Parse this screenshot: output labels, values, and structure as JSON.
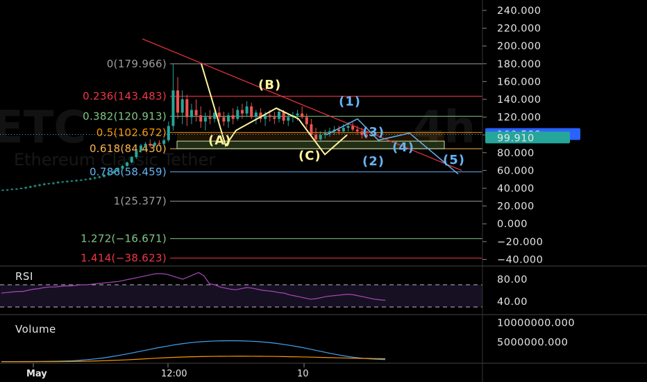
{
  "chart_data": {
    "type": "candlestick",
    "symbol_watermark": "ETC",
    "interval_watermark": "4h",
    "watermark_subtitle": "Ethereum Classic Tether",
    "price_axis": {
      "ticks": [
        "240.000",
        "220.000",
        "200.000",
        "180.000",
        "160.000",
        "140.000",
        "120.000",
        "100.000",
        "80.000",
        "60.000",
        "40.000",
        "20.000",
        "0.000",
        "−20.000",
        "−40.000"
      ],
      "tick_values": [
        240,
        220,
        200,
        180,
        160,
        140,
        120,
        100,
        80,
        60,
        40,
        20,
        0,
        -20,
        -40
      ],
      "ylim": [
        -42,
        247
      ]
    },
    "current_price": {
      "label": "100.588",
      "value": 100.588,
      "color": "#2962ff"
    },
    "secondary_price": {
      "label": "99.910",
      "value": 99.91,
      "color": "#26a69a"
    },
    "time_axis": {
      "labels": [
        "May",
        "12:00",
        "10"
      ]
    },
    "fibonacci": [
      {
        "label": "0(179.966)",
        "value": 179.966,
        "color": "#9e9e9e"
      },
      {
        "label": "0.236(143.483)",
        "value": 143.483,
        "color": "#f23645"
      },
      {
        "label": "0.382(120.913)",
        "value": 120.913,
        "color": "#81c784"
      },
      {
        "label": "0.5(102.672)",
        "value": 102.672,
        "color": "#ff9800"
      },
      {
        "label": "0.618(84.430)",
        "value": 84.43,
        "color": "#ffb74d"
      },
      {
        "label": "0.786(58.459)",
        "value": 58.459,
        "color": "#64b5f6"
      },
      {
        "label": "1(25.377)",
        "value": 25.377,
        "color": "#9e9e9e"
      },
      {
        "label": "1.272(−16.671)",
        "value": -16.671,
        "color": "#81c784"
      },
      {
        "label": "1.414(−38.623)",
        "value": -38.623,
        "color": "#f23645"
      }
    ],
    "waves_abc": [
      {
        "label": "(A)",
        "value": 81,
        "color": "#fff59d"
      },
      {
        "label": "(B)",
        "value": 138,
        "color": "#fff59d"
      },
      {
        "label": "(C)",
        "value": 65,
        "color": "#fff59d"
      }
    ],
    "waves_impulse": [
      {
        "label": "(1)",
        "value": 133,
        "color": "#64b5f6"
      },
      {
        "label": "(2)",
        "value": 58,
        "color": "#64b5f6"
      },
      {
        "label": "(3)",
        "value": 98,
        "color": "#64b5f6"
      },
      {
        "label": "(4)",
        "value": 79,
        "color": "#64b5f6"
      },
      {
        "label": "(5)",
        "value": 70,
        "color": "#64b5f6"
      }
    ],
    "candles": [
      [
        38,
        39,
        37,
        38
      ],
      [
        38,
        39,
        37,
        38.5
      ],
      [
        38.5,
        40,
        38,
        39
      ],
      [
        39,
        40,
        38,
        39.5
      ],
      [
        39.5,
        41,
        39,
        40
      ],
      [
        40,
        42,
        39,
        41
      ],
      [
        41,
        43,
        40,
        42
      ],
      [
        42,
        44,
        41,
        43
      ],
      [
        43,
        45,
        42,
        44
      ],
      [
        44,
        46,
        43,
        45
      ],
      [
        45,
        46,
        44,
        45.5
      ],
      [
        45.5,
        47,
        44,
        46
      ],
      [
        46,
        48,
        45,
        47
      ],
      [
        47,
        48,
        46,
        47.5
      ],
      [
        47.5,
        49,
        46,
        48
      ],
      [
        48,
        49,
        47,
        48.5
      ],
      [
        48.5,
        50,
        47,
        49
      ],
      [
        49,
        50,
        48,
        49.5
      ],
      [
        49.5,
        51,
        49,
        50
      ],
      [
        50,
        52,
        49,
        51
      ],
      [
        51,
        53,
        50,
        52
      ],
      [
        52,
        54,
        51,
        53
      ],
      [
        53,
        56,
        52,
        55
      ],
      [
        55,
        58,
        54,
        57
      ],
      [
        57,
        60,
        56,
        59
      ],
      [
        59,
        63,
        58,
        62
      ],
      [
        62,
        66,
        61,
        65
      ],
      [
        65,
        70,
        64,
        69
      ],
      [
        69,
        76,
        68,
        75
      ],
      [
        75,
        83,
        73,
        82
      ],
      [
        82,
        90,
        80,
        88
      ],
      [
        88,
        92,
        84,
        90
      ],
      [
        90,
        95,
        86,
        88
      ],
      [
        88,
        93,
        85,
        91
      ],
      [
        91,
        94,
        87,
        90
      ],
      [
        90,
        96,
        88,
        94
      ],
      [
        94,
        115,
        92,
        110
      ],
      [
        110,
        180,
        105,
        150
      ],
      [
        150,
        165,
        118,
        125
      ],
      [
        125,
        150,
        112,
        140
      ],
      [
        140,
        145,
        110,
        120
      ],
      [
        120,
        135,
        112,
        128
      ],
      [
        128,
        140,
        115,
        122
      ],
      [
        122,
        132,
        108,
        115
      ],
      [
        115,
        125,
        105,
        120
      ],
      [
        120,
        128,
        112,
        118
      ],
      [
        118,
        130,
        114,
        125
      ],
      [
        125,
        132,
        115,
        120
      ],
      [
        120,
        126,
        110,
        115
      ],
      [
        115,
        125,
        108,
        122
      ],
      [
        122,
        130,
        112,
        118
      ],
      [
        118,
        132,
        116,
        128
      ],
      [
        128,
        135,
        118,
        124
      ],
      [
        124,
        138,
        120,
        132
      ],
      [
        132,
        136,
        118,
        120
      ],
      [
        120,
        128,
        112,
        125
      ],
      [
        125,
        130,
        114,
        118
      ],
      [
        118,
        126,
        110,
        122
      ],
      [
        122,
        128,
        115,
        120
      ],
      [
        120,
        126,
        112,
        118
      ],
      [
        118,
        130,
        114,
        126
      ],
      [
        126,
        128,
        112,
        116
      ],
      [
        116,
        124,
        110,
        120
      ],
      [
        120,
        126,
        114,
        122
      ],
      [
        122,
        128,
        116,
        124
      ],
      [
        124,
        132,
        118,
        120
      ],
      [
        120,
        124,
        108,
        112
      ],
      [
        112,
        118,
        98,
        100
      ],
      [
        100,
        108,
        92,
        95
      ],
      [
        95,
        104,
        92,
        100
      ],
      [
        100,
        106,
        96,
        102
      ],
      [
        102,
        108,
        98,
        104
      ],
      [
        104,
        110,
        100,
        106
      ],
      [
        106,
        110,
        100,
        104
      ],
      [
        104,
        112,
        102,
        108
      ],
      [
        108,
        114,
        104,
        110
      ],
      [
        110,
        114,
        104,
        106
      ],
      [
        106,
        110,
        100,
        104
      ],
      [
        104,
        108,
        96,
        100
      ],
      [
        100,
        104,
        96,
        98
      ]
    ],
    "resistance_line": {
      "from": [
        0.33,
        208
      ],
      "to": [
        0.93,
        60
      ],
      "color": "#f23645"
    },
    "rsi": {
      "title": "RSI",
      "ticks": [
        "80.00",
        "40.00"
      ],
      "tick_values": [
        80,
        40
      ],
      "upper": 70,
      "lower": 30,
      "ylim": [
        20,
        100
      ],
      "color": "#ab47bc",
      "values": [
        55,
        56,
        57,
        58,
        58,
        60,
        62,
        63,
        65,
        66,
        66,
        67,
        68,
        68,
        69,
        70,
        70,
        71,
        72,
        73,
        74,
        75,
        76,
        78,
        80,
        82,
        84,
        86,
        88,
        90,
        90,
        89,
        86,
        83,
        80,
        84,
        88,
        92,
        86,
        72,
        70,
        66,
        64,
        62,
        61,
        63,
        65,
        64,
        62,
        60,
        59,
        58,
        56,
        55,
        52,
        50,
        48,
        46,
        44,
        45,
        47,
        49,
        50,
        51,
        52,
        53,
        52,
        50,
        48,
        46,
        44,
        43,
        42
      ]
    },
    "volume": {
      "title": "Volume",
      "ticks": [
        "10000000.000",
        "5000000.000"
      ],
      "tick_values": [
        10000000,
        5000000
      ],
      "ylim": [
        0,
        11500000
      ],
      "ma_color": "#42a5f5",
      "vol_color": "#ff9800",
      "ma_values": [
        60000,
        70000,
        80000,
        90000,
        100000,
        120000,
        140000,
        170000,
        210000,
        280000,
        400000,
        560000,
        760000,
        1000000,
        1300000,
        1650000,
        2000000,
        2400000,
        2800000,
        3200000,
        3600000,
        3950000,
        4300000,
        4600000,
        4850000,
        5050000,
        5200000,
        5300000,
        5350000,
        5380000,
        5370000,
        5330000,
        5250000,
        5130000,
        4950000,
        4730000,
        4460000,
        4150000,
        3800000,
        3420000,
        3000000,
        2580000,
        2160000,
        1780000,
        1440000,
        1160000,
        940000,
        780000,
        660000,
        580000
      ],
      "vol_values": [
        30000,
        35000,
        40000,
        45000,
        50000,
        55000,
        60000,
        70000,
        80000,
        100000,
        130000,
        170000,
        220000,
        280000,
        350000,
        430000,
        520000,
        620000,
        730000,
        850000,
        960000,
        1060000,
        1150000,
        1220000,
        1280000,
        1330000,
        1370000,
        1400000,
        1420000,
        1430000,
        1440000,
        1440000,
        1430000,
        1420000,
        1400000,
        1380000,
        1350000,
        1310000,
        1270000,
        1230000,
        1180000,
        1130000,
        1080000,
        1030000,
        980000,
        930000,
        890000,
        860000,
        830000,
        800000
      ]
    }
  }
}
